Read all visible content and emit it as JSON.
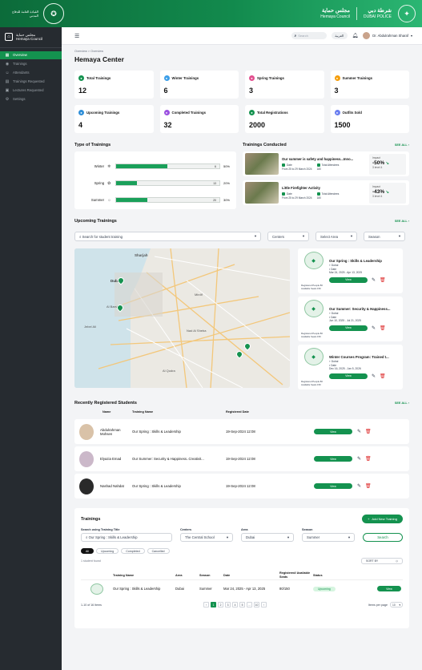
{
  "topbar": {
    "logo_left": "القيادة العامة للدفاع المدني",
    "brand_ar": "مجلس حماية",
    "brand_en": "Hemaya Council",
    "police_ar": "شرطة دبي",
    "police_en": "DUBAI POLICE"
  },
  "sidebar": {
    "brand_ar": "مجلس حماية",
    "brand_en": "Hemaya Council",
    "items": [
      {
        "label": "Overview",
        "icon": "grid-icon"
      },
      {
        "label": "Trainings",
        "icon": "training-icon"
      },
      {
        "label": "Attendants",
        "icon": "users-icon"
      },
      {
        "label": "Trainings Requested",
        "icon": "doc-icon"
      },
      {
        "label": "Lectures Requested",
        "icon": "lecture-icon"
      },
      {
        "label": "Settings",
        "icon": "gear-icon"
      }
    ]
  },
  "header": {
    "search_placeholder": "Search",
    "language": "العربية",
    "user": "Dr. Abdulrahman Sharaf"
  },
  "breadcrumb": "Overview > Overview",
  "page_title": "Hemaya Center",
  "stats": [
    {
      "label": "Total Trainings",
      "value": "12",
      "color": "#14924f"
    },
    {
      "label": "Winter Trainings",
      "value": "6",
      "color": "#3b9ee8"
    },
    {
      "label": "Spring Trainings",
      "value": "3",
      "color": "#e24f8f"
    },
    {
      "label": "Summer Trainings",
      "value": "3",
      "color": "#f59e0b"
    },
    {
      "label": "Upcoming Trainings",
      "value": "4",
      "color": "#2f8fd8"
    },
    {
      "label": "Completed Trainings",
      "value": "32",
      "color": "#9b51e0"
    },
    {
      "label": "Total Registrations",
      "value": "2000",
      "color": "#14924f"
    },
    {
      "label": "Outfits Sold",
      "value": "1500",
      "color": "#6b7ff0"
    }
  ],
  "type_of_trainings": {
    "title": "Type of Trainings",
    "rows": [
      {
        "label": "Winter",
        "icon": "snowflake-icon",
        "count": "6",
        "percent": "50%",
        "fill": 0.5
      },
      {
        "label": "Spring",
        "icon": "flower-icon",
        "count": "13",
        "percent": "20%",
        "fill": 0.2
      },
      {
        "label": "Summer",
        "icon": "sun-icon",
        "count": "20",
        "percent": "30%",
        "fill": 0.3
      }
    ]
  },
  "trainings_conducted": {
    "title": "Trainings Conducted",
    "see_all": "SEE ALL",
    "items": [
      {
        "title": "Our summer is safety and happiness...Inno...",
        "date_label": "Date",
        "date": "From 25 to 29 March 2024",
        "att_label": "Total Attendees",
        "attendees": "180",
        "impact_label": "Impact",
        "impact": "-50%",
        "impact_sub": "3 level 4"
      },
      {
        "title": "Little Firefighter Activity",
        "date_label": "Date",
        "date": "From 25 to 29 March 2024",
        "att_label": "Total Attendees",
        "attendees": "180",
        "impact_label": "Impact",
        "impact": "-43%",
        "impact_sub": "3 level 4"
      }
    ]
  },
  "upcoming": {
    "title": "Upcoming Trainings",
    "see_all": "SEE ALL",
    "search_placeholder": "Search for student training",
    "centers": "Centers",
    "area": "Select Area",
    "season": "Season",
    "map_labels": [
      "Sharjah",
      "Dubai",
      "Jebel Ali",
      "Al Barsha",
      "Mirdif",
      "Nad Al Sheba",
      "Al Qudra"
    ],
    "events": [
      {
        "title": "Our Spring : Skills & Leadership",
        "location": "Dubai",
        "date_label": "Date",
        "date": "Mar 24, 2025 - Apr 13, 2025",
        "reg_label": "Registered People",
        "registered": "80",
        "avail_label": "Available Seats",
        "available": "150",
        "view": "View"
      },
      {
        "title": "Our Summer: Security & Happiness...",
        "location": "Dubai",
        "date_label": "Date",
        "date": "Jun 10, 2025 - Jul 21, 2025",
        "reg_label": "Registered People",
        "registered": "80",
        "avail_label": "Available Seats",
        "available": "150",
        "view": "View"
      },
      {
        "title": "Winter Courses Program: Trained t...",
        "location": "Dubai",
        "date_label": "Date",
        "date": "Dec 16, 2025 - Jan 5, 2026",
        "reg_label": "Registered People",
        "registered": "80",
        "avail_label": "Available Seats",
        "available": "150",
        "view": "View"
      }
    ]
  },
  "students": {
    "title": "Recently Registered Students",
    "see_all": "SEE ALL",
    "cols": [
      "Name",
      "Training Name",
      "Registered Date"
    ],
    "rows": [
      {
        "name": "Abdulrahman Mohsen",
        "training": "Our Spring : Skills & Leadership",
        "date": "19-Sep-2024 12:08",
        "view": "View"
      },
      {
        "name": "Elyazia Emad",
        "training": "Our Summer: Security & Happiness..Creativit...",
        "date": "19-Sep-2024 12:08",
        "view": "View"
      },
      {
        "name": "Nashad Nahdat",
        "training": "Our Spring : Skills & Leadership",
        "date": "19-Sep-2024 12:08",
        "view": "View"
      }
    ]
  },
  "trainings": {
    "title": "Trainings",
    "add": "Add New Training",
    "search_label": "Search using Training Title",
    "search_value": "Our Spring : Skills & Leadership",
    "centers_label": "Centers",
    "centers_value": "The Central School",
    "area_label": "Area",
    "area_value": "Dubai",
    "season_label": "Season",
    "season_value": "Summer",
    "search_btn": "Search",
    "chips": [
      "All",
      "Upcoming",
      "Completed",
      "Cancelled"
    ],
    "found": "1 student found",
    "sort": "SORT BY",
    "cols": [
      "Training Name",
      "Area",
      "Season",
      "Date",
      "Registered/ Available Seats",
      "Status"
    ],
    "row": {
      "name": "Our Spring : Skills & Leadership",
      "area": "Dubai",
      "season": "Summer",
      "date": "Mar 24, 2025 - Apr 13, 2025",
      "seats": "80/150",
      "status": "Upcoming",
      "view": "View"
    },
    "pagination_info": "1-10 of 16 Items",
    "pages": [
      "1",
      "2",
      "3",
      "4",
      "5",
      "...",
      "10"
    ],
    "per_page_label": "Items per page",
    "per_page": "10"
  }
}
